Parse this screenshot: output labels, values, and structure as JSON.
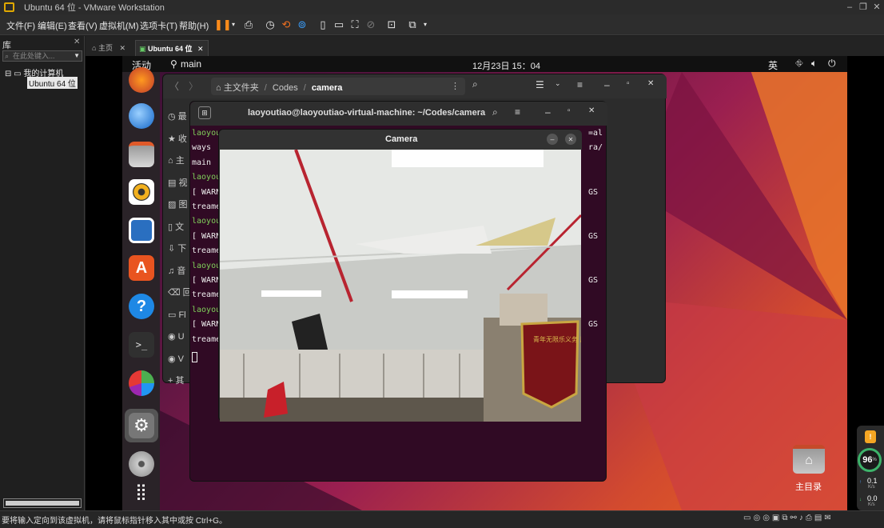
{
  "window": {
    "title": "Ubuntu 64 位 - VMware Workstation"
  },
  "menu": {
    "items": [
      "文件(F)",
      "编辑(E)",
      "查看(V)",
      "虚拟机(M)",
      "选项卡(T)",
      "帮助(H)"
    ]
  },
  "library": {
    "title": "库",
    "search_placeholder": "在此处键入...",
    "root": "我的计算机",
    "child": "Ubuntu 64 位"
  },
  "tabs": {
    "home": "主页",
    "vm": "Ubuntu 64 位"
  },
  "ubuntu": {
    "activities": "活动",
    "app_name": "main",
    "clock": "12月23日 15：04",
    "ime": "英",
    "files": {
      "path_home": "主文件夹",
      "path_codes": "Codes",
      "path_current": "camera",
      "sidebar": [
        "最",
        "收",
        "主",
        "视",
        "图",
        "文",
        "下",
        "音",
        "回",
        "Fl",
        "U",
        "V",
        "其"
      ]
    },
    "terminal": {
      "title": "laoyoutiao@laoyoutiao-virtual-machine: ~/Codes/camera",
      "lines": [
        {
          "t": "laoyou",
          "g": true,
          "r": "=al"
        },
        {
          "t": "ways",
          "g": false,
          "r": "ra/"
        },
        {
          "t": "main",
          "g": false,
          "r": ""
        },
        {
          "t": "laoyou",
          "g": true,
          "r": ""
        },
        {
          "t": "[ WARN",
          "g": false,
          "r": "GS"
        },
        {
          "t": "treame",
          "g": false,
          "r": ""
        },
        {
          "t": "laoyou",
          "g": true,
          "r": ""
        },
        {
          "t": "[ WARN",
          "g": false,
          "r": "GS"
        },
        {
          "t": "treame",
          "g": false,
          "r": ""
        },
        {
          "t": "laoyou",
          "g": true,
          "r": ""
        },
        {
          "t": "[ WARN",
          "g": false,
          "r": "GS"
        },
        {
          "t": "treame",
          "g": false,
          "r": ""
        },
        {
          "t": "laoyou",
          "g": true,
          "r": ""
        },
        {
          "t": "[ WARN",
          "g": false,
          "r": "GS"
        },
        {
          "t": "treame",
          "g": false,
          "r": ""
        }
      ]
    },
    "camera": {
      "title": "Camera",
      "banner": "青年无限乐义务 用爱心对生命负责 敬赠"
    },
    "desktop_icon": "主目录"
  },
  "widget": {
    "percent": "96",
    "percent_unit": "%",
    "up": "0.1",
    "up_unit": "K/s",
    "down": "0.0",
    "down_unit": "K/s"
  },
  "status": {
    "message": "要将输入定向到该虚拟机，请将鼠标指针移入其中或按 Ctrl+G。"
  }
}
